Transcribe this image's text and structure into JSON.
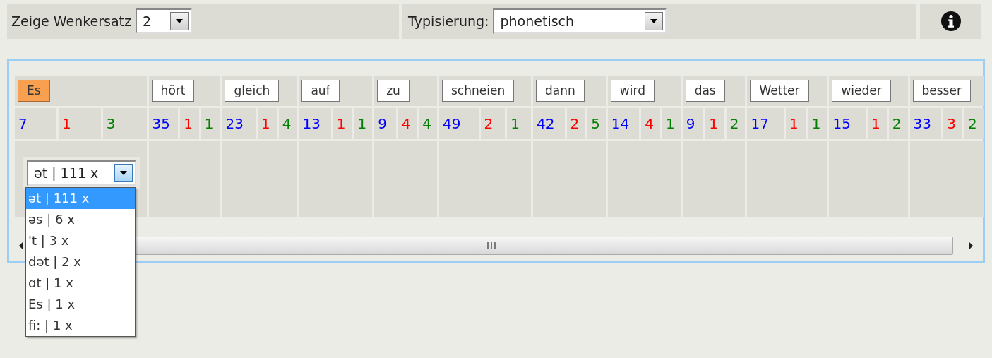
{
  "toolbar": {
    "sentence_label": "Zeige Wenkersatz",
    "sentence_select": {
      "value": "2"
    },
    "typing_label": "Typisierung:",
    "typing_select": {
      "value": "phonetisch"
    }
  },
  "words": [
    {
      "text": "Es",
      "selected": true,
      "counts": [
        {
          "value": "7",
          "color": "#0000ff"
        },
        {
          "value": "1",
          "color": "#ff0000"
        },
        {
          "value": "3",
          "color": "#008000"
        }
      ]
    },
    {
      "text": "hört",
      "selected": false,
      "counts": [
        {
          "value": "35",
          "color": "#0000ff"
        },
        {
          "value": "1",
          "color": "#ff0000"
        },
        {
          "value": "1",
          "color": "#008000"
        }
      ]
    },
    {
      "text": "gleich",
      "selected": false,
      "counts": [
        {
          "value": "23",
          "color": "#0000ff"
        },
        {
          "value": "1",
          "color": "#ff0000"
        },
        {
          "value": "4",
          "color": "#008000"
        }
      ]
    },
    {
      "text": "auf",
      "selected": false,
      "counts": [
        {
          "value": "13",
          "color": "#0000ff"
        },
        {
          "value": "1",
          "color": "#ff0000"
        },
        {
          "value": "1",
          "color": "#008000"
        }
      ]
    },
    {
      "text": "zu",
      "selected": false,
      "counts": [
        {
          "value": "9",
          "color": "#0000ff"
        },
        {
          "value": "4",
          "color": "#ff0000"
        },
        {
          "value": "4",
          "color": "#008000"
        }
      ]
    },
    {
      "text": "schneien",
      "selected": false,
      "counts": [
        {
          "value": "49",
          "color": "#0000ff"
        },
        {
          "value": "2",
          "color": "#ff0000"
        },
        {
          "value": "1",
          "color": "#008000"
        }
      ]
    },
    {
      "text": "dann",
      "selected": false,
      "counts": [
        {
          "value": "42",
          "color": "#0000ff"
        },
        {
          "value": "2",
          "color": "#ff0000"
        },
        {
          "value": "5",
          "color": "#008000"
        }
      ]
    },
    {
      "text": "wird",
      "selected": false,
      "counts": [
        {
          "value": "14",
          "color": "#0000ff"
        },
        {
          "value": "4",
          "color": "#ff0000"
        },
        {
          "value": "1",
          "color": "#008000"
        }
      ]
    },
    {
      "text": "das",
      "selected": false,
      "counts": [
        {
          "value": "9",
          "color": "#0000ff"
        },
        {
          "value": "1",
          "color": "#ff0000"
        },
        {
          "value": "2",
          "color": "#008000"
        }
      ]
    },
    {
      "text": "Wetter",
      "selected": false,
      "counts": [
        {
          "value": "17",
          "color": "#0000ff"
        },
        {
          "value": "1",
          "color": "#ff0000"
        },
        {
          "value": "1",
          "color": "#008000"
        }
      ]
    },
    {
      "text": "wieder",
      "selected": false,
      "counts": [
        {
          "value": "15",
          "color": "#0000ff"
        },
        {
          "value": "1",
          "color": "#ff0000"
        },
        {
          "value": "2",
          "color": "#008000"
        }
      ]
    },
    {
      "text": "besser",
      "selected": false,
      "counts": [
        {
          "value": "33",
          "color": "#0000ff"
        },
        {
          "value": "3",
          "color": "#ff0000"
        },
        {
          "value": "2",
          "color": "#008000"
        }
      ]
    }
  ],
  "variant_select": {
    "value": "ət | 111 x",
    "expanded": true,
    "options": [
      {
        "label": "ət | 111 x",
        "selected": true
      },
      {
        "label": "əs | 6 x",
        "selected": false
      },
      {
        "label": "'t | 3 x",
        "selected": false
      },
      {
        "label": "dət | 2 x",
        "selected": false
      },
      {
        "label": "ɑt | 1 x",
        "selected": false
      },
      {
        "label": "Es | 1 x",
        "selected": false
      },
      {
        "label": "fi: | 1 x",
        "selected": false
      }
    ]
  }
}
